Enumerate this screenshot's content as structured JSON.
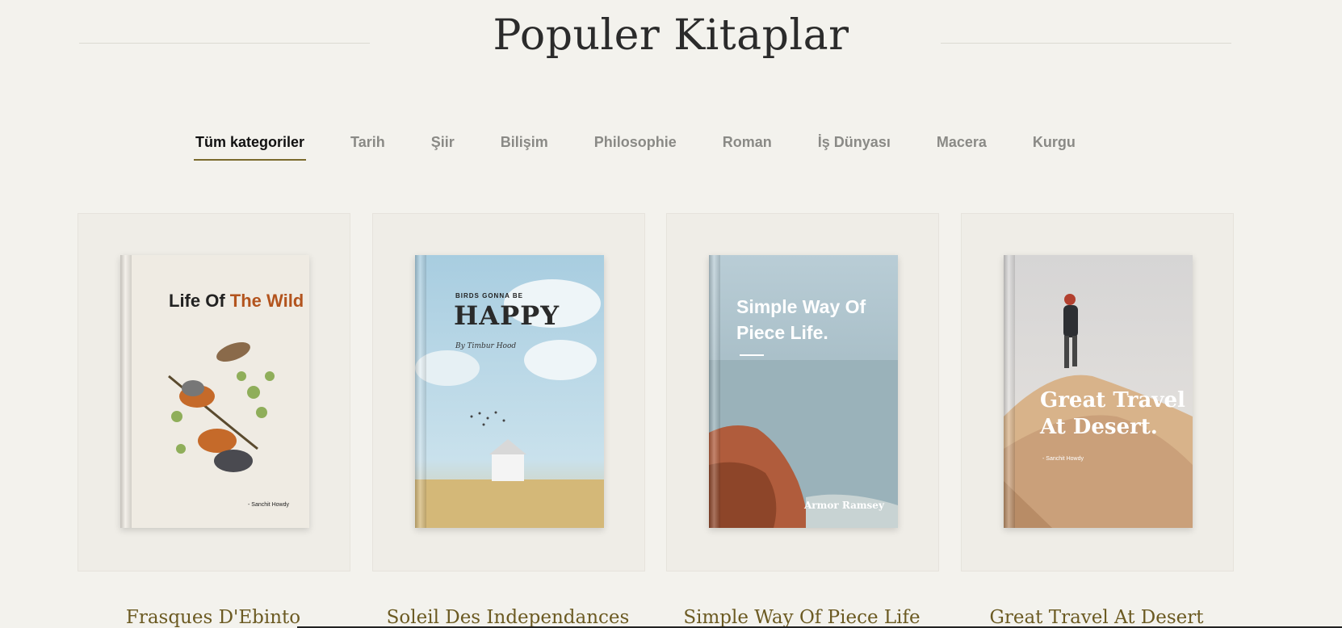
{
  "section": {
    "title": "Populer Kitaplar"
  },
  "tabs": [
    {
      "label": "Tüm kategoriler",
      "active": true
    },
    {
      "label": "Tarih"
    },
    {
      "label": "Şiir"
    },
    {
      "label": "Bilişim"
    },
    {
      "label": "Philosophie"
    },
    {
      "label": "Roman"
    },
    {
      "label": "İş Dünyası"
    },
    {
      "label": "Macera"
    },
    {
      "label": "Kurgu"
    }
  ],
  "books": [
    {
      "title": "Frasques D'Ebinto",
      "cover": {
        "title_a": "Life Of ",
        "title_b": "The Wild",
        "author": "- Sanchit Howdy"
      }
    },
    {
      "title": "Soleil Des Independances",
      "cover": {
        "kicker": "BIRDS GONNA BE",
        "title": "HAPPY",
        "author": "By Timbur Hood"
      }
    },
    {
      "title": "Simple Way Of Piece Life",
      "cover": {
        "line1": "Simple Way Of",
        "line2": "Piece Life.",
        "author": "Armor Ramsey"
      }
    },
    {
      "title": "Great Travel At Desert",
      "cover": {
        "line1": "Great Travel",
        "line2": "At Desert.",
        "author": "- Sanchit Howdy"
      }
    }
  ]
}
